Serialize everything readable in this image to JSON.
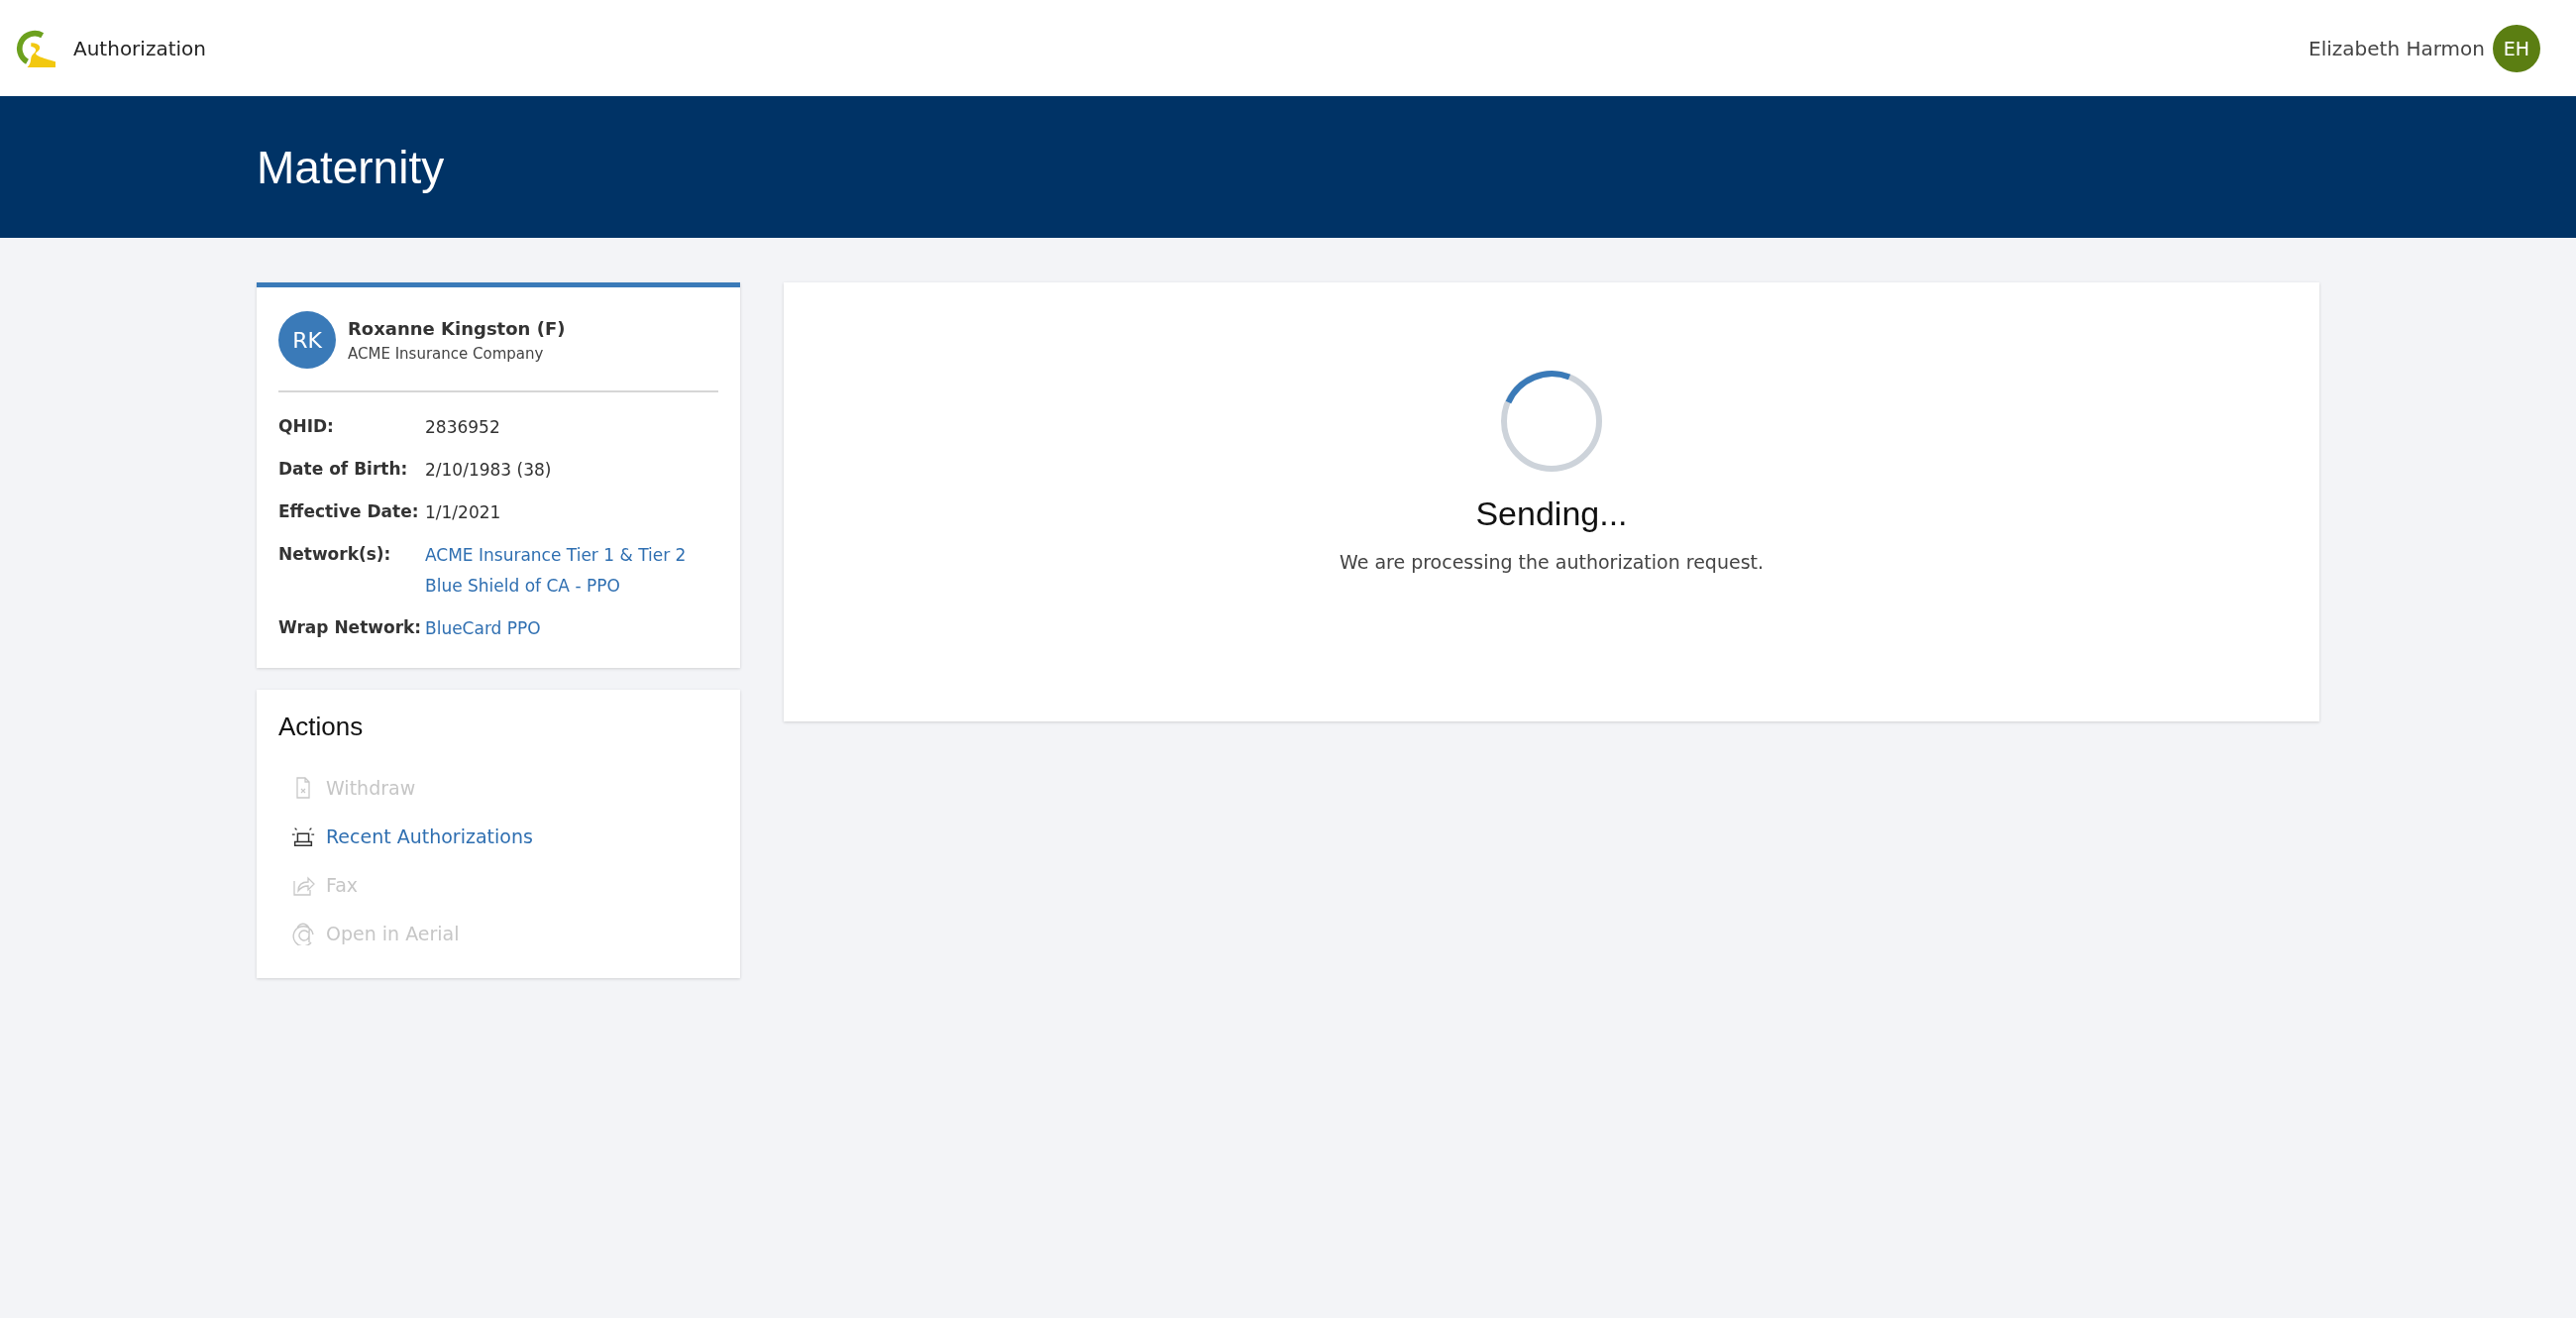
{
  "app_bar": {
    "title": "Authorization",
    "user": {
      "name": "Elizabeth Harmon",
      "initials": "EH"
    }
  },
  "banner": {
    "title": "Maternity"
  },
  "patient": {
    "initials": "RK",
    "name": "Roxanne Kingston (F)",
    "insurer": "ACME Insurance Company",
    "fields": [
      {
        "label": "QHID:",
        "values": [
          "2836952"
        ],
        "link": false
      },
      {
        "label": "Date of Birth:",
        "values": [
          "2/10/1983 (38)"
        ],
        "link": false
      },
      {
        "label": "Effective Date:",
        "values": [
          "1/1/2021"
        ],
        "link": false
      },
      {
        "label": "Network(s):",
        "values": [
          "ACME Insurance Tier 1 & Tier 2",
          "Blue Shield of CA - PPO"
        ],
        "link": true
      },
      {
        "label": "Wrap Network:",
        "values": [
          "BlueCard PPO"
        ],
        "link": true
      }
    ]
  },
  "actions": {
    "title": "Actions",
    "items": [
      {
        "kind": "withdraw",
        "label": "Withdraw",
        "disabled": true
      },
      {
        "kind": "alarm",
        "label": "Recent Authorizations",
        "disabled": false
      },
      {
        "kind": "share",
        "label": "Fax",
        "disabled": true
      },
      {
        "kind": "aerial",
        "label": "Open in Aerial",
        "disabled": true
      }
    ]
  },
  "status": {
    "title": "Sending...",
    "message": "We are processing the authorization request."
  }
}
